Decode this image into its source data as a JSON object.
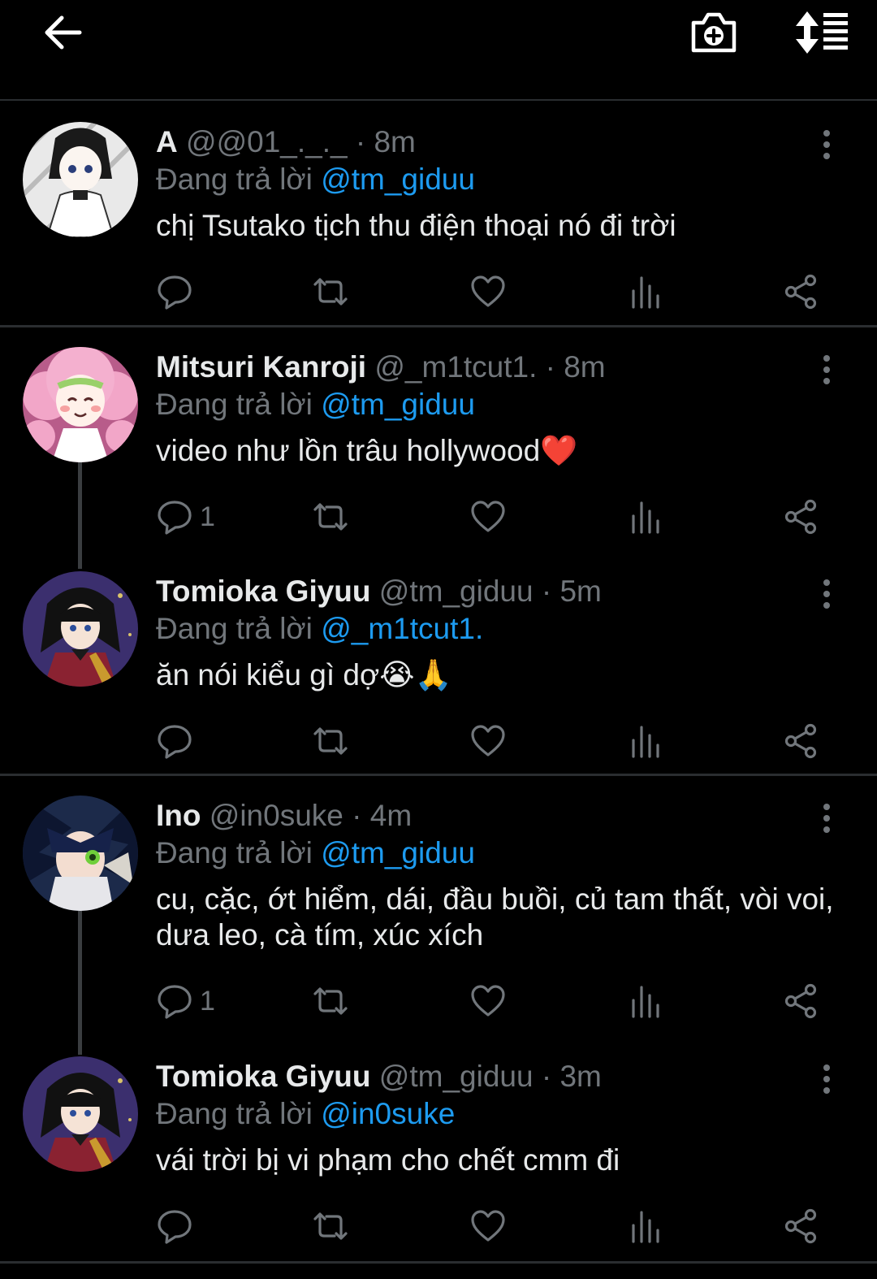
{
  "reply_prefix": "Đang trả lời",
  "tweets": [
    {
      "name": "A",
      "handle": "@@01_._._",
      "time": "8m",
      "reply_to": "@tm_giduu",
      "text": "chị Tsutako tịch thu điện thoại nó đi trời",
      "reply_count": ""
    },
    {
      "name": "Mitsuri Kanroji",
      "handle": "@_m1tcut1.",
      "time": "8m",
      "reply_to": "@tm_giduu",
      "text": "video như lồn trâu hollywood❤️",
      "reply_count": "1"
    },
    {
      "name": "Tomioka Giyuu",
      "handle": "@tm_giduu",
      "time": "5m",
      "reply_to": "@_m1tcut1.",
      "text": "ăn nói kiểu gì dợ😭🙏",
      "reply_count": ""
    },
    {
      "name": "Ino",
      "handle": "@in0suke",
      "time": "4m",
      "reply_to": "@tm_giduu",
      "text": "cu, cặc, ớt hiểm, dái, đầu buồi, củ tam thất, vòi voi, dưa leo, cà tím, xúc xích",
      "reply_count": "1"
    },
    {
      "name": "Tomioka Giyuu",
      "handle": "@tm_giduu",
      "time": "3m",
      "reply_to": "@in0suke",
      "text": "vái trời bị vi phạm cho chết cmm đi",
      "reply_count": ""
    }
  ],
  "colors": {
    "background": "#000000",
    "text": "#e7e9ea",
    "muted": "#71767b",
    "mention": "#1d9bf0",
    "divider": "#2a2d30"
  },
  "icons": {
    "back": "arrow-left-icon",
    "camera": "camera-plus-icon",
    "sort": "sort-icon",
    "reply": "speech-bubble-icon",
    "retweet": "retweet-icon",
    "like": "heart-icon",
    "views": "bar-chart-icon",
    "share": "share-icon",
    "more": "vertical-dots-icon"
  }
}
